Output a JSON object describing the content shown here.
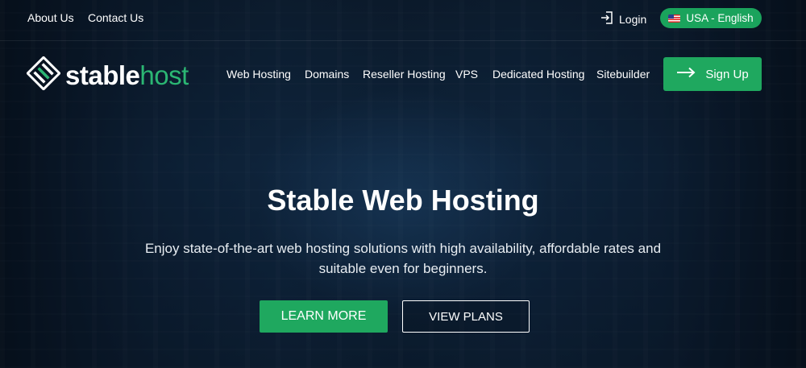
{
  "topbar": {
    "links": [
      "About Us",
      "Contact Us"
    ],
    "login_label": "Login",
    "language_label": "USA - English"
  },
  "brand": {
    "name_bold": "stable",
    "name_light": "host",
    "accent_color": "#1fa85f"
  },
  "nav": {
    "items": [
      "Web Hosting",
      "Domains",
      "Reseller Hosting",
      "VPS",
      "Dedicated Hosting",
      "Sitebuilder"
    ],
    "signup_label": "Sign Up"
  },
  "hero": {
    "title": "Stable Web Hosting",
    "subtitle": "Enjoy state-of-the-art web hosting solutions with high availability, affordable rates and suitable even for beginners.",
    "primary_cta": "LEARN MORE",
    "secondary_cta": "VIEW PLANS"
  }
}
